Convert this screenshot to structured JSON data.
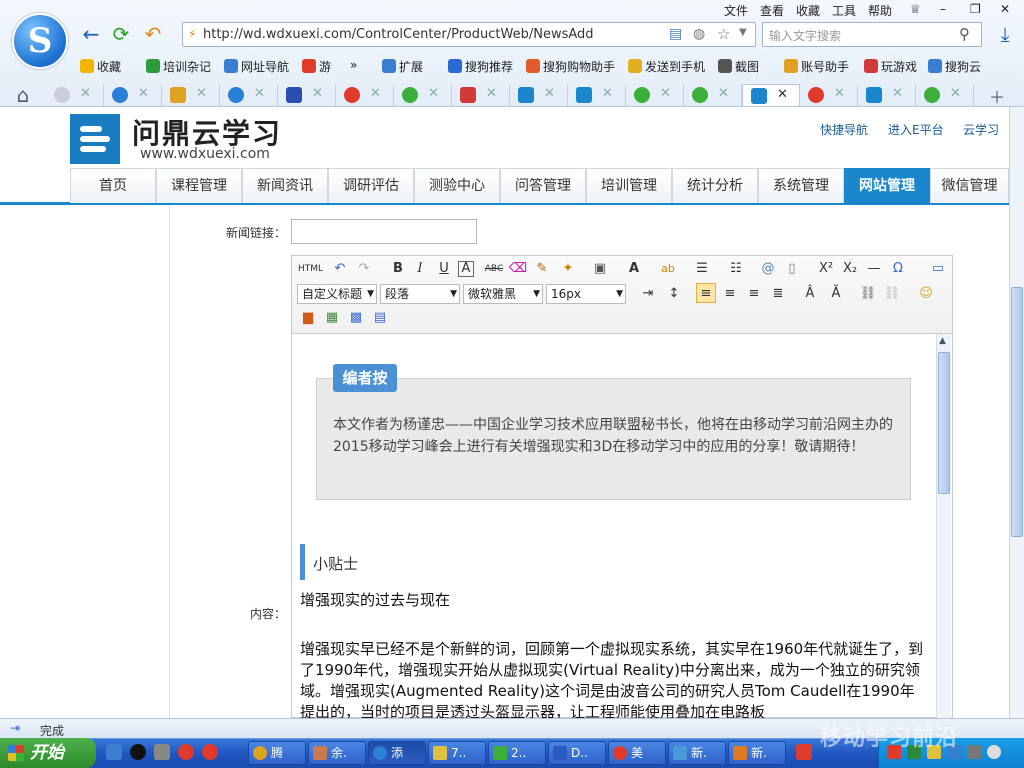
{
  "browser": {
    "menu": [
      "文件",
      "查看",
      "收藏",
      "工具",
      "帮助"
    ],
    "address_url": "http://wd.wdxuexi.com/ControlCenter/ProductWeb/NewsAdd",
    "search_placeholder": "输入文字搜索",
    "favorites": [
      "收藏",
      "培训杂记",
      "网址导航",
      "游",
      "扩展",
      "搜狗推荐",
      "搜狗购物助手",
      "发送到手机",
      "截图",
      "账号助手",
      "玩游戏",
      "搜狗云"
    ]
  },
  "site": {
    "name": "问鼎云学习",
    "url_text": "www.wdxuexi.com",
    "header_links": [
      "快捷导航",
      "进入E平台",
      "云学习"
    ],
    "nav": [
      "首页",
      "课程管理",
      "新闻资讯",
      "调研评估",
      "测验中心",
      "问答管理",
      "培训管理",
      "统计分析",
      "系统管理",
      "网站管理",
      "微信管理"
    ],
    "active_nav": "网站管理"
  },
  "form": {
    "news_link_label": "新闻链接：",
    "content_label": "内容："
  },
  "editor": {
    "selects": [
      "自定义标题",
      "段落",
      "微软雅黑",
      "16px"
    ],
    "note_tag": "编者按",
    "note_text": "本文作者为杨谨忠——中国企业学习技术应用联盟秘书长，他将在由移动学习前沿网主办的2015移动学习峰会上进行有关增强现实和3D在移动学习中的应用的分享！敬请期待！",
    "tip_title": "小贴士",
    "para_title": "增强现实的过去与现在",
    "para_body": "增强现实早已经不是个新鲜的词，回顾第一个虚拟现实系统，其实早在1960年代就诞生了，到了1990年代，增强现实开始从虚拟现实(Virtual Reality)中分离出来，成为一个独立的研究领域。增强现实(Augmented Reality)这个词是由波音公司的研究人员Tom Caudell在1990年提出的，当时的项目是透过头盔显示器，让工程师能使用叠加在电路板"
  },
  "status": {
    "text": "完成"
  },
  "taskbar": {
    "start": "开始",
    "tasks": [
      "腾",
      "余.",
      "添",
      "7..",
      "2..",
      "D..",
      "美",
      "新.",
      "新."
    ],
    "watermark": "移动学习前沿"
  }
}
